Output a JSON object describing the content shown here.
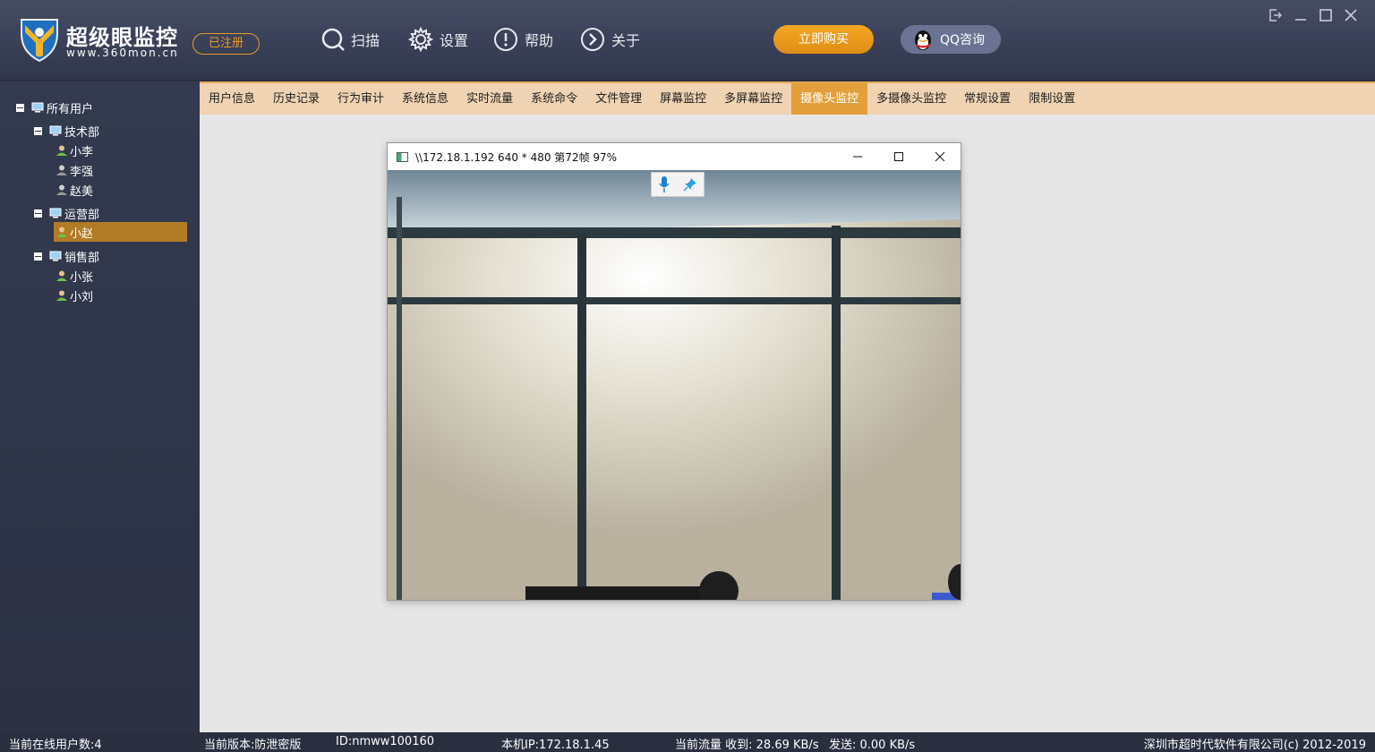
{
  "header": {
    "brand_name": "超级眼监控",
    "brand_url": "www.360mon.cn",
    "registered": "已注册",
    "nav": [
      {
        "label": "扫描",
        "icon": "search-icon"
      },
      {
        "label": "设置",
        "icon": "gear-icon"
      },
      {
        "label": "帮助",
        "icon": "exclamation-icon"
      },
      {
        "label": "关于",
        "icon": "chevron-right-icon"
      }
    ],
    "buy_label": "立即购买",
    "qq_label": "QQ咨询"
  },
  "sidebar": {
    "root": "所有用户",
    "groups": [
      {
        "name": "技术部",
        "users": [
          "小李",
          "李强",
          "赵美"
        ]
      },
      {
        "name": "运营部",
        "users": [
          "小赵"
        ]
      },
      {
        "name": "销售部",
        "users": [
          "小张",
          "小刘"
        ]
      }
    ],
    "selected_user": "小赵"
  },
  "tabs": [
    "用户信息",
    "历史记录",
    "行为审计",
    "系统信息",
    "实时流量",
    "系统命令",
    "文件管理",
    "屏幕监控",
    "多屏幕监控",
    "摄像头监控",
    "多摄像头监控",
    "常规设置",
    "限制设置"
  ],
  "active_tab": "摄像头监控",
  "camera_window": {
    "title": "\\\\172.18.1.192 640 * 480 第72帧 97%"
  },
  "status": {
    "online_users": "当前在线用户数:4",
    "version": "当前版本:防泄密版",
    "id": "ID:nmww100160",
    "local_ip": "本机IP:172.18.1.45",
    "traffic_recv": "当前流量 收到: 28.69 KB/s",
    "traffic_send": "发送: 0.00 KB/s",
    "copyright": "深圳市超时代软件有限公司(c) 2012-2019"
  },
  "colors": {
    "accent_orange": "#e3a03a",
    "header_bg": "#3a4057",
    "selection": "#b27b25"
  }
}
